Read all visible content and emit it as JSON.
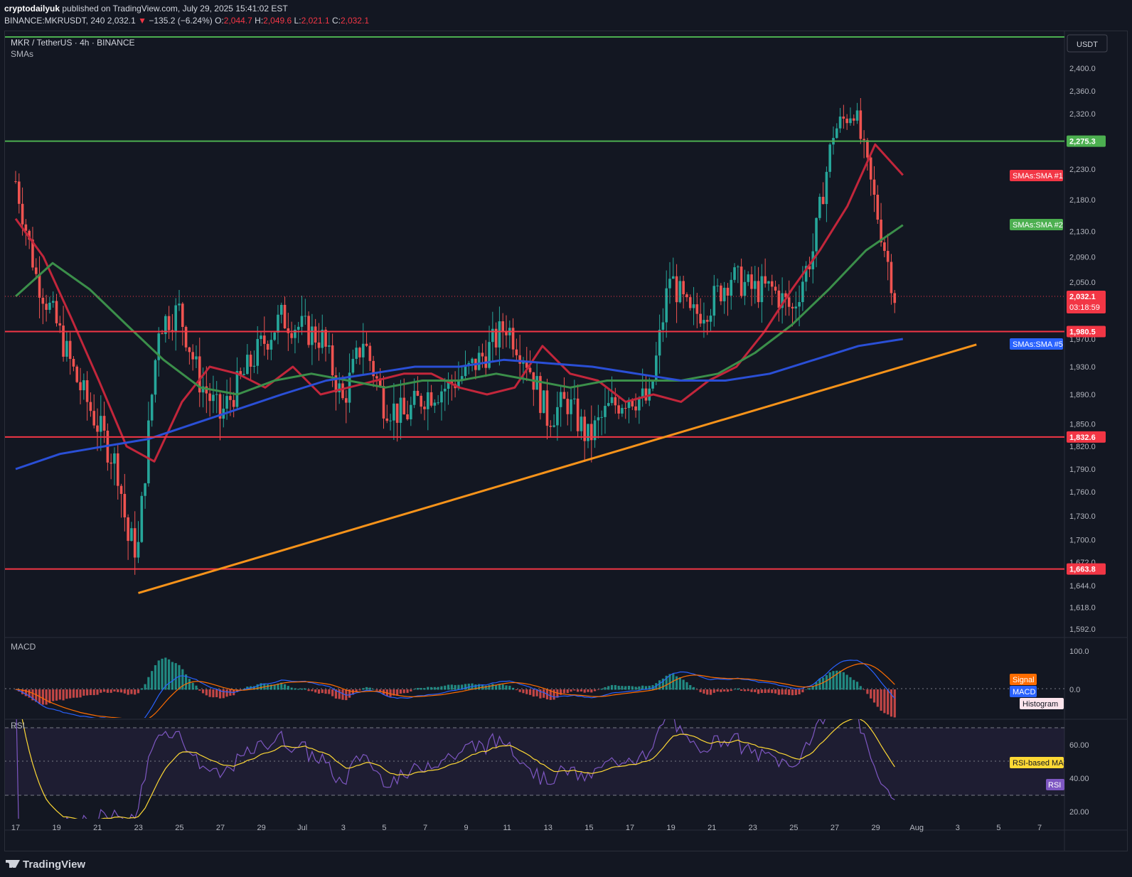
{
  "header": {
    "publisher": "cryptodailyuk",
    "published_text": "published on TradingView.com, July 29, 2025 15:41:02 EST",
    "symbol_line": "BINANCE:MKRUSDT, 240",
    "last": "2,032.1",
    "change_arrow": "▼",
    "change": "−135.2 (−6.24%)",
    "o_label": "O:",
    "o": "2,044.7",
    "h_label": "H:",
    "h": "2,049.6",
    "l_label": "L:",
    "l": "2,021.1",
    "c_label": "C:",
    "c": "2,032.1"
  },
  "legend": {
    "title": "MKR / TetherUS · 4h · BINANCE",
    "indicator": "SMAs"
  },
  "currency_badge": "USDT",
  "price_tags": {
    "top_green": "2,275.3",
    "current": "2,032.1",
    "countdown": "03:18:59",
    "r1": "1,980.5",
    "r2": "1,832.6",
    "r3": "1,663.8",
    "sma1": "SMAs:SMA #1",
    "sma2": "SMAs:SMA #2",
    "sma5": "SMAs:SMA #5"
  },
  "macd_panel": {
    "title": "MACD",
    "signal": "Signal",
    "macd": "MACD",
    "histogram": "Histogram"
  },
  "rsi_panel": {
    "title": "RSI",
    "ma": "RSI-based MA",
    "rsi": "RSI"
  },
  "footer": {
    "brand": "TradingView"
  },
  "colors": {
    "sma1": "#c2263b",
    "sma2": "#3b8f4a",
    "sma5": "#2a4fd6",
    "trendline": "#f7931a",
    "level_green": "#4caf50",
    "level_red": "#f23645"
  },
  "chart_data": {
    "type": "line",
    "title": "MKR / TetherUS · 4h · BINANCE",
    "y_ticks": [
      "2,400.0",
      "2,360.0",
      "2,320.0",
      "2,230.0",
      "2,180.0",
      "2,130.0",
      "2,090.0",
      "2,050.0",
      "1,970.0",
      "1,930.0",
      "1,890.0",
      "1,850.0",
      "1,820.0",
      "1,790.0",
      "1,760.0",
      "1,730.0",
      "1,700.0",
      "1,672.0",
      "1,644.0",
      "1,618.0",
      "1,592.0"
    ],
    "x_ticks": [
      "17",
      "19",
      "21",
      "23",
      "25",
      "27",
      "29",
      "Jul",
      "3",
      "5",
      "7",
      "9",
      "11",
      "13",
      "15",
      "17",
      "19",
      "21",
      "23",
      "25",
      "27",
      "29",
      "Aug",
      "3",
      "5",
      "7"
    ],
    "macd_ticks": [
      "100.0",
      "0.0"
    ],
    "rsi_ticks": [
      "60.00",
      "40.00",
      "20.00"
    ],
    "x_range": [
      "2025-06-17",
      "2025-08-07"
    ],
    "horizontal_levels": [
      {
        "value": 2275.3,
        "color": "green"
      },
      {
        "value": 1980.5,
        "color": "red"
      },
      {
        "value": 1832.6,
        "color": "red"
      },
      {
        "value": 1663.8,
        "color": "red"
      }
    ],
    "trendline": {
      "from": {
        "date": "2025-06-23",
        "price": 1635
      },
      "to": {
        "date": "2025-08-02",
        "price": 1962
      }
    },
    "price_series": {
      "name": "MKRUSDT close",
      "dates": [
        "06-17",
        "06-18",
        "06-19",
        "06-20",
        "06-21",
        "06-22",
        "06-22T12",
        "06-23",
        "06-24",
        "06-25",
        "06-26",
        "06-27",
        "06-28",
        "06-29",
        "06-30",
        "07-01",
        "07-02",
        "07-03",
        "07-04",
        "07-05",
        "07-06",
        "07-07",
        "07-08",
        "07-09",
        "07-10",
        "07-11",
        "07-12",
        "07-13",
        "07-14",
        "07-15",
        "07-16",
        "07-17",
        "07-18",
        "07-19",
        "07-20",
        "07-21",
        "07-22",
        "07-23",
        "07-24",
        "07-25",
        "07-26",
        "07-27",
        "07-28",
        "07-29"
      ],
      "values": [
        2210,
        2060,
        1990,
        1910,
        1850,
        1790,
        1700,
        1690,
        1990,
        2010,
        1910,
        1860,
        1910,
        1960,
        2000,
        1970,
        1880,
        1970,
        1880,
        1860,
        1890,
        1900,
        1920,
        1950,
        1990,
        1940,
        1860,
        1880,
        1830,
        1870,
        1890,
        1880,
        2060,
        2000,
        2020,
        2060,
        2040,
        2040,
        2010,
        2100,
        2290,
        2330,
        2180,
        2032
      ]
    },
    "series": [
      {
        "name": "SMAs:SMA #1",
        "values": [
          2150,
          2090,
          2000,
          1910,
          1820,
          1800,
          1880,
          1930,
          1920,
          1900,
          1930,
          1890,
          1900,
          1910,
          1920,
          1920,
          1900,
          1890,
          1900,
          1960,
          1920,
          1910,
          1880,
          1890,
          1880,
          1910,
          1930,
          1980,
          2040,
          2100,
          2170,
          2270,
          2220
        ]
      },
      {
        "name": "SMAs:SMA #2",
        "values": [
          2030,
          2080,
          2040,
          1990,
          1940,
          1900,
          1890,
          1910,
          1920,
          1910,
          1900,
          1910,
          1910,
          1920,
          1910,
          1900,
          1910,
          1910,
          1910,
          1920,
          1950,
          1990,
          2040,
          2100,
          2140
        ]
      },
      {
        "name": "SMAs:SMA #5",
        "values": [
          1790,
          1810,
          1820,
          1830,
          1850,
          1870,
          1890,
          1910,
          1920,
          1930,
          1930,
          1940,
          1935,
          1930,
          1920,
          1910,
          1910,
          1920,
          1940,
          1960,
          1970
        ]
      }
    ]
  }
}
